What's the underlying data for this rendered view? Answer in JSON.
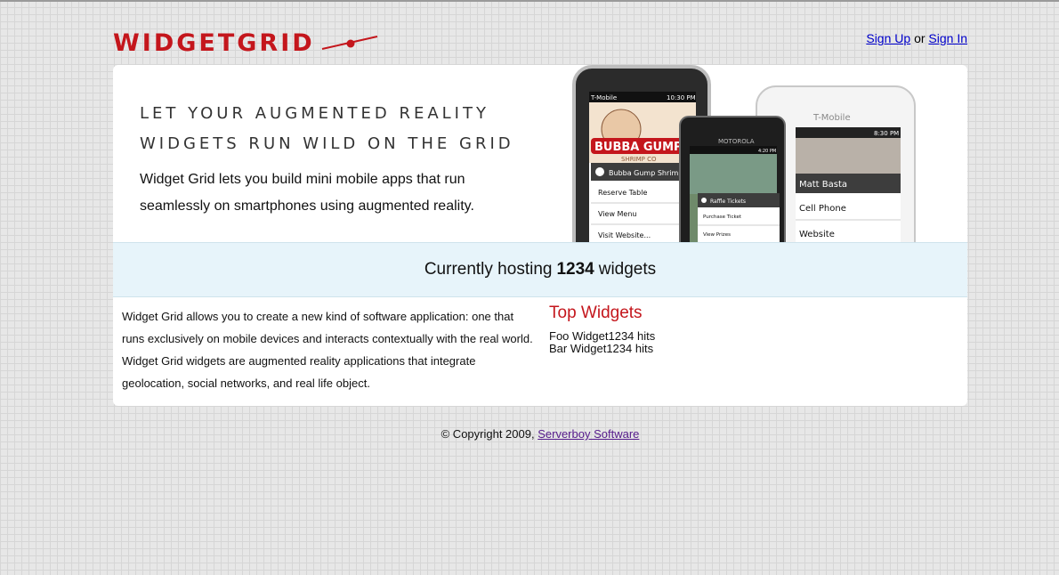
{
  "header": {
    "logo_text": "WIDGETGRID",
    "sign_up": "Sign Up",
    "separator": "or",
    "sign_in": "Sign In"
  },
  "hero": {
    "headline_line1": "Let your augmented reality",
    "headline_line2": "widgets run wild on the grid",
    "intro": "Widget Grid lets you build mini mobile apps that run seamlessly on smartphones using augmented reality.",
    "phones": {
      "phone1": {
        "carrier": "T-Mobile",
        "time": "10:30 PM",
        "banner": "BUBBA GUMP",
        "banner_sub": "SHRIMP CO",
        "menu_title": "Bubba Gump Shrimp",
        "items": [
          "Reserve Table",
          "View Menu",
          "Visit Website..."
        ]
      },
      "phone2": {
        "brand": "MOTOROLA",
        "time": "4:20 PM",
        "menu_title": "Raffle Tickets",
        "items": [
          "Purchase Ticket",
          "View Prizes"
        ]
      },
      "phone3": {
        "carrier": "T-Mobile",
        "time": "8:30 PM",
        "menu_title": "Matt Basta",
        "items": [
          "Cell Phone",
          "Website"
        ]
      }
    }
  },
  "hosting": {
    "prefix": "Currently hosting",
    "count": "1234",
    "suffix": "widgets"
  },
  "about": {
    "text": "Widget Grid allows you to create a new kind of software application: one that runs exclusively on mobile devices and interacts contextually with the real world. Widget Grid widgets are augmented reality applications that integrate geolocation, social networks, and real life object."
  },
  "top_widgets": {
    "title": "Top Widgets",
    "items": [
      {
        "name": "Foo Widget",
        "hits": "1234 hits"
      },
      {
        "name": "Bar Widget",
        "hits": "1234 hits"
      }
    ]
  },
  "footer": {
    "copyright": "© Copyright 2009,",
    "company": "Serverboy Software"
  },
  "colors": {
    "brand_red": "#c4161c",
    "hosting_bg": "#e7f4fa",
    "link_blue": "#0000cc",
    "visited_purple": "#551a8b"
  }
}
